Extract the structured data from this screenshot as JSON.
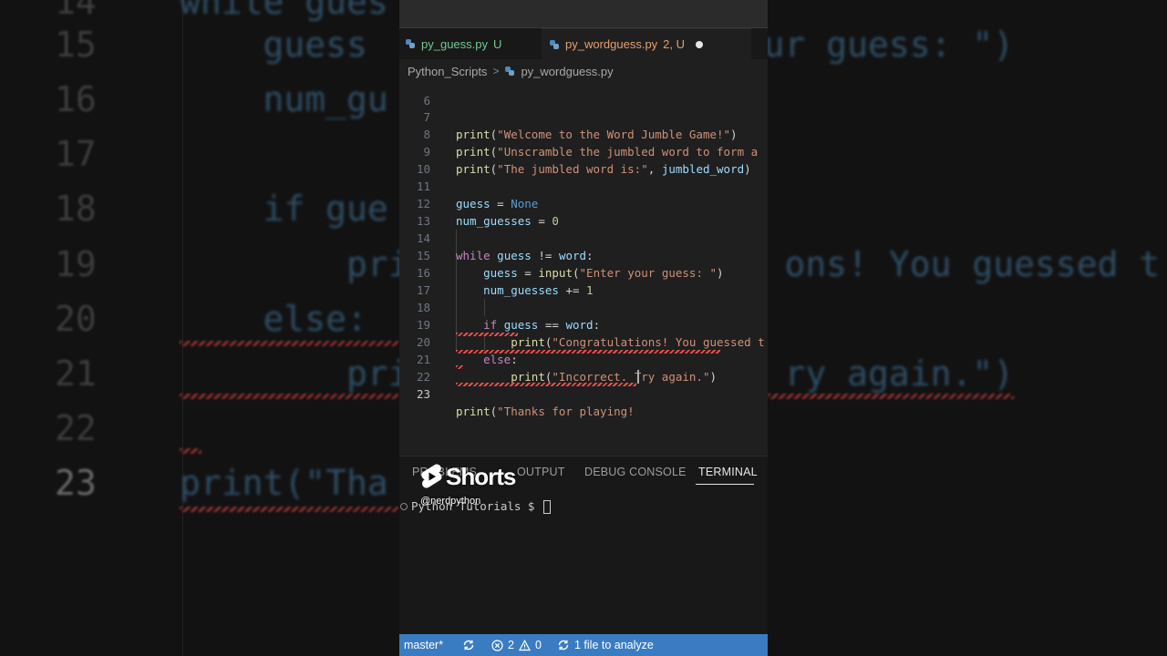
{
  "background_zoom": {
    "lines": [
      {
        "num": "14",
        "code": "while gues"
      },
      {
        "num": "15",
        "code": "    guess                   ur guess: \")"
      },
      {
        "num": "16",
        "code": "    num_gu"
      },
      {
        "num": "17",
        "code": ""
      },
      {
        "num": "18",
        "code": "    if gue"
      },
      {
        "num": "19",
        "code": "        pri                  ons! You guessed t"
      },
      {
        "num": "20",
        "code": "    else:"
      },
      {
        "num": "21",
        "code": "        pri                  ry again.\")"
      },
      {
        "num": "22",
        "code": ""
      },
      {
        "num": "23",
        "code": "print(\"Tha"
      }
    ]
  },
  "tabs": [
    {
      "label": "py_guess.py",
      "state": "U",
      "icon": "python-file-icon"
    },
    {
      "label": "py_wordguess.py",
      "state": "2, U",
      "icon": "python-file-icon",
      "active": true,
      "unsaved": true
    }
  ],
  "breadcrumb": {
    "folder": "Python_Scripts",
    "file": "py_wordguess.py"
  },
  "editor": {
    "lines": [
      {
        "num": "6"
      },
      {
        "num": "7",
        "code": "print(\"Welcome to the Word Jumble Game!\")"
      },
      {
        "num": "8",
        "code": "print(\"Unscramble the jumbled word to form a"
      },
      {
        "num": "9",
        "code": "print(\"The jumbled word is:\", jumbled_word)"
      },
      {
        "num": "10",
        "code": ""
      },
      {
        "num": "11",
        "code": "guess = None"
      },
      {
        "num": "12",
        "code": "num_guesses = 0"
      },
      {
        "num": "13",
        "code": ""
      },
      {
        "num": "14",
        "code": "while guess != word:"
      },
      {
        "num": "15",
        "code": "    guess = input(\"Enter your guess: \")"
      },
      {
        "num": "16",
        "code": "    num_guesses += 1"
      },
      {
        "num": "17",
        "code": ""
      },
      {
        "num": "18",
        "code": "    if guess == word:"
      },
      {
        "num": "19",
        "code": "        print(\"Congratulations! You guessed t"
      },
      {
        "num": "20",
        "code": "    else:"
      },
      {
        "num": "21",
        "code": "        print(\"Incorrect. Try again.\")"
      },
      {
        "num": "22",
        "code": ""
      },
      {
        "num": "23",
        "code": "print(\"Thanks for playing!"
      }
    ]
  },
  "panel": {
    "tabs": [
      "PROBLEMS",
      "OUTPUT",
      "DEBUG CONSOLE",
      "TERMINAL"
    ],
    "active_tab": "TERMINAL",
    "terminal_prompt": "Python Tutorials $ "
  },
  "statusbar": {
    "branch": "master*",
    "errors": "2",
    "warnings": "0",
    "analyze": "1 file to analyze"
  },
  "overlay": {
    "brand": "Shorts",
    "handle": "@nerdpython"
  },
  "colors": {
    "statusbar": "#3a7cc2",
    "untracked_tab": "#73c991",
    "modified_tab": "#e2a06f"
  }
}
